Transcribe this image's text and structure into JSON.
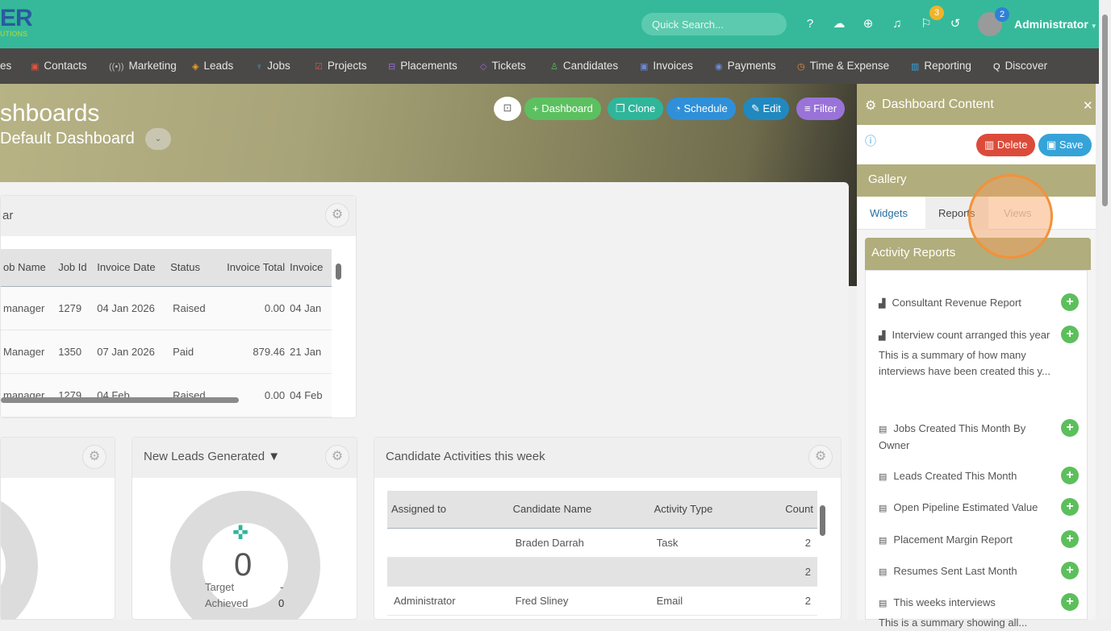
{
  "header": {
    "logo_text": "ER",
    "logo_sub": "UTIONS",
    "search_placeholder": "Quick Search...",
    "flag_badge": "3",
    "avatar_badge": "2",
    "user": "Administrator"
  },
  "nav": [
    {
      "label": "es",
      "icon": ""
    },
    {
      "label": "Contacts",
      "icon": "▣",
      "color": "#e0533f"
    },
    {
      "label": "Marketing",
      "icon": "((•))",
      "color": "#bbb"
    },
    {
      "label": "Leads",
      "icon": "◈",
      "color": "#f0a020"
    },
    {
      "label": "Jobs",
      "icon": "♆",
      "color": "#3aa0d8"
    },
    {
      "label": "Projects",
      "icon": "☑",
      "color": "#e0533f"
    },
    {
      "label": "Placements",
      "icon": "⊟",
      "color": "#9a6ad8"
    },
    {
      "label": "Tickets",
      "icon": "◇",
      "color": "#9a6ad8"
    },
    {
      "label": "Candidates",
      "icon": "♙",
      "color": "#5cbf5c"
    },
    {
      "label": "Invoices",
      "icon": "▣",
      "color": "#6a8ad8"
    },
    {
      "label": "Payments",
      "icon": "◉",
      "color": "#6a8ad8"
    },
    {
      "label": "Time & Expense",
      "icon": "◷",
      "color": "#f0903a"
    },
    {
      "label": "Reporting",
      "icon": "▥",
      "color": "#3aa0d8"
    },
    {
      "label": "Discover",
      "icon": "Q",
      "color": "#fff"
    }
  ],
  "page": {
    "title": "shboards",
    "subtitle": "Default Dashboard"
  },
  "toolbar": {
    "dashboard": "+ Dashboard",
    "clone": "Clone",
    "schedule": "Schedule",
    "edit": "Edit",
    "filter": "Filter"
  },
  "invoice_widget": {
    "title": "ar",
    "columns": [
      "ob Name",
      "Job Id",
      "Invoice Date",
      "Status",
      "Invoice Total",
      "Invoice"
    ],
    "rows": [
      [
        "manager",
        "1279",
        "04 Jan 2026",
        "Raised",
        "0.00",
        "04 Jan"
      ],
      [
        "Manager",
        "1350",
        "07 Jan 2026",
        "Paid",
        "879.46",
        "21 Jan"
      ],
      [
        "manager",
        "1279",
        "04 Feb",
        "Raised",
        "0.00",
        "04 Feb"
      ]
    ]
  },
  "leads_widget": {
    "title": "New Leads Generated",
    "value": "0",
    "target_label": "Target",
    "target_value": "-",
    "achieved_label": "Achieved",
    "achieved_value": "0"
  },
  "activities_widget": {
    "title": "Candidate Activities this week",
    "columns": [
      "Assigned to",
      "Candidate Name",
      "Activity Type",
      "Count"
    ],
    "rows": [
      [
        "",
        "Braden Darrah",
        "Task",
        "2"
      ],
      [
        "",
        "",
        "",
        "2"
      ],
      [
        "Administrator",
        "Fred Sliney",
        "Email",
        "2"
      ]
    ]
  },
  "panel": {
    "title": "Dashboard Content",
    "delete": "Delete",
    "save": "Save",
    "gallery": "Gallery",
    "tabs": [
      "Widgets",
      "Reports",
      "Views"
    ],
    "section": "Activity Reports",
    "reports": [
      {
        "name": "Consultant Revenue Report",
        "icon": "chart"
      },
      {
        "name": "Interview count arranged this year",
        "icon": "chart",
        "desc": "This is a summary of how many interviews have been created this y..."
      },
      {
        "name": "Jobs Created This Month By Owner",
        "icon": "table"
      },
      {
        "name": "Leads Created This Month",
        "icon": "table"
      },
      {
        "name": "Open Pipeline Estimated Value",
        "icon": "table"
      },
      {
        "name": "Placement Margin Report",
        "icon": "table"
      },
      {
        "name": "Resumes Sent Last Month",
        "icon": "table"
      },
      {
        "name": "This weeks interviews",
        "icon": "table",
        "desc": "This is a summary showing all..."
      }
    ]
  }
}
